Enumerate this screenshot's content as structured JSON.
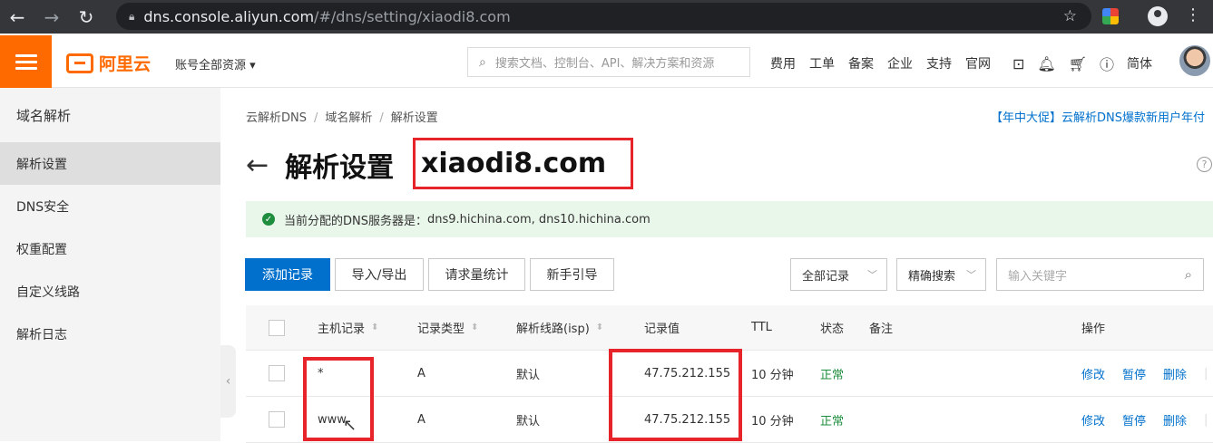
{
  "browser": {
    "url_host": "dns.console.aliyun.com",
    "url_path": "/#/dns/setting/xiaodi8.com"
  },
  "topbar": {
    "logo_text": "阿里云",
    "account_switch": "账号全部资源",
    "search_placeholder": "搜索文档、控制台、API、解决方案和资源",
    "links": [
      "费用",
      "工单",
      "备案",
      "企业",
      "支持",
      "官网"
    ],
    "lang": "简体"
  },
  "sidebar": {
    "title": "域名解析",
    "items": [
      {
        "label": "解析设置",
        "active": true
      },
      {
        "label": "DNS安全"
      },
      {
        "label": "权重配置"
      },
      {
        "label": "自定义线路"
      },
      {
        "label": "解析日志"
      }
    ]
  },
  "breadcrumb": [
    "云解析DNS",
    "域名解析",
    "解析设置"
  ],
  "promo": "【年中大促】云解析DNS爆款新用户年付",
  "page": {
    "title": "解析设置",
    "domain": "xiaodi8.com"
  },
  "notice": {
    "label": "当前分配的DNS服务器是：",
    "servers": "dns9.hichina.com, dns10.hichina.com"
  },
  "toolbar": {
    "add": "添加记录",
    "import_export": "导入/导出",
    "stats": "请求量统计",
    "guide": "新手引导",
    "filter_all": "全部记录",
    "precise_search": "精确搜索",
    "keyword_placeholder": "输入关键字"
  },
  "table": {
    "headers": {
      "host": "主机记录",
      "type": "记录类型",
      "line": "解析线路(isp)",
      "value": "记录值",
      "ttl": "TTL",
      "status": "状态",
      "remark": "备注",
      "ops": "操作"
    },
    "rows": [
      {
        "host": "*",
        "type": "A",
        "line": "默认",
        "value": "47.75.212.155",
        "ttl": "10 分钟",
        "status": "正常",
        "remark": ""
      },
      {
        "host": "www",
        "type": "A",
        "line": "默认",
        "value": "47.75.212.155",
        "ttl": "10 分钟",
        "status": "正常",
        "remark": ""
      }
    ],
    "ops": {
      "edit": "修改",
      "pause": "暂停",
      "delete": "删除"
    }
  },
  "colors": {
    "brand": "#ff6a00",
    "primary": "#0070cc",
    "annotation": "#e8242b",
    "ok": "#1e8e3e"
  }
}
